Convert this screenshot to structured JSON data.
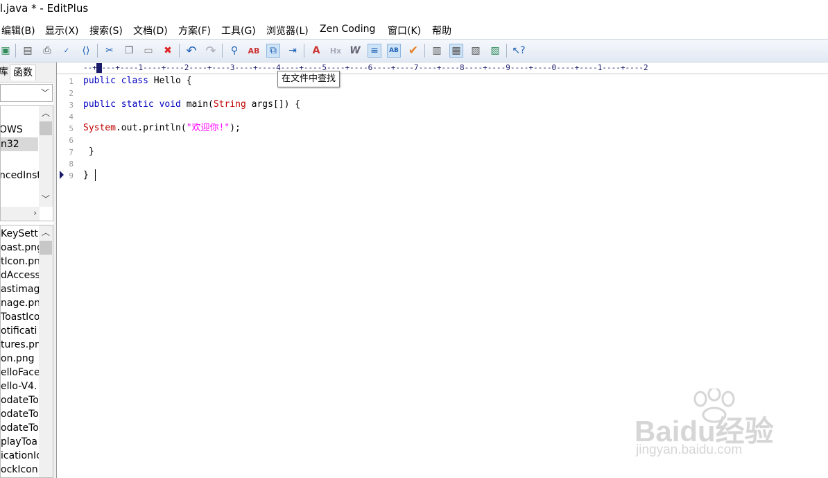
{
  "window": {
    "title": "l.java * - EditPlus"
  },
  "menu": [
    "编辑(B)",
    "显示(X)",
    "搜索(S)",
    "文档(D)",
    "方案(F)",
    "工具(G)",
    "浏览器(L)",
    "Zen Coding",
    "窗口(K)",
    "帮助"
  ],
  "toolbar": {
    "tooltip": "在文件中查找",
    "icons": [
      "save-all-icon",
      "print-preview-icon",
      "print-icon",
      "spellcheck-icon",
      "html-view-icon",
      "cut-icon",
      "copy-icon",
      "paste-icon",
      "delete-icon",
      "undo-icon",
      "redo-icon",
      "find-icon",
      "replace-icon",
      "find-in-files-icon",
      "goto-line-icon",
      "font-icon",
      "heading-icon",
      "word-wrap-icon",
      "line-number-icon",
      "ruler-icon",
      "check-icon",
      "panel-1-icon",
      "panel-2-icon",
      "panel-3-icon",
      "panel-4-icon",
      "help-pointer-icon"
    ]
  },
  "left_panel": {
    "tabs": [
      "库",
      "函数"
    ],
    "dir_list": [
      "OWS",
      "n32",
      "ncedInst",
      "."
    ],
    "file_list": [
      "KeySettin",
      "oast.png",
      "tIcon.pn",
      "dAccess",
      "astimag",
      "nage.png",
      "ToastIco",
      "otificati",
      "tures.pn",
      "on.png",
      "elloFace",
      "ello-V4.",
      "odateTo",
      "odateTo",
      "odateTo",
      "playToa",
      "icationIc",
      "ockIcon"
    ]
  },
  "editor": {
    "ruler": "--+----+----1----+----2----+----3----+----4----+----5----+----6----+----7----+----8----+----9----+----0----+----1----+----2",
    "line_numbers": [
      "1",
      "2",
      "3",
      "4",
      "5",
      "6",
      "7",
      "8",
      "9"
    ],
    "code": {
      "l1_kw": "public class",
      "l1_rest": " Hello {",
      "l3_kw1": "public static void",
      "l3_mid": " main(",
      "l3_type": "String",
      "l3_rest": " args[]) {",
      "l5_type": "System",
      "l5_mid": ".out.println(",
      "l5_str": "\"欢迎你!\"",
      "l5_end": ");",
      "l7": " }",
      "l9": "}"
    }
  },
  "watermark": {
    "brand": "Baidu经验",
    "url": "jingyan.baidu.com"
  }
}
